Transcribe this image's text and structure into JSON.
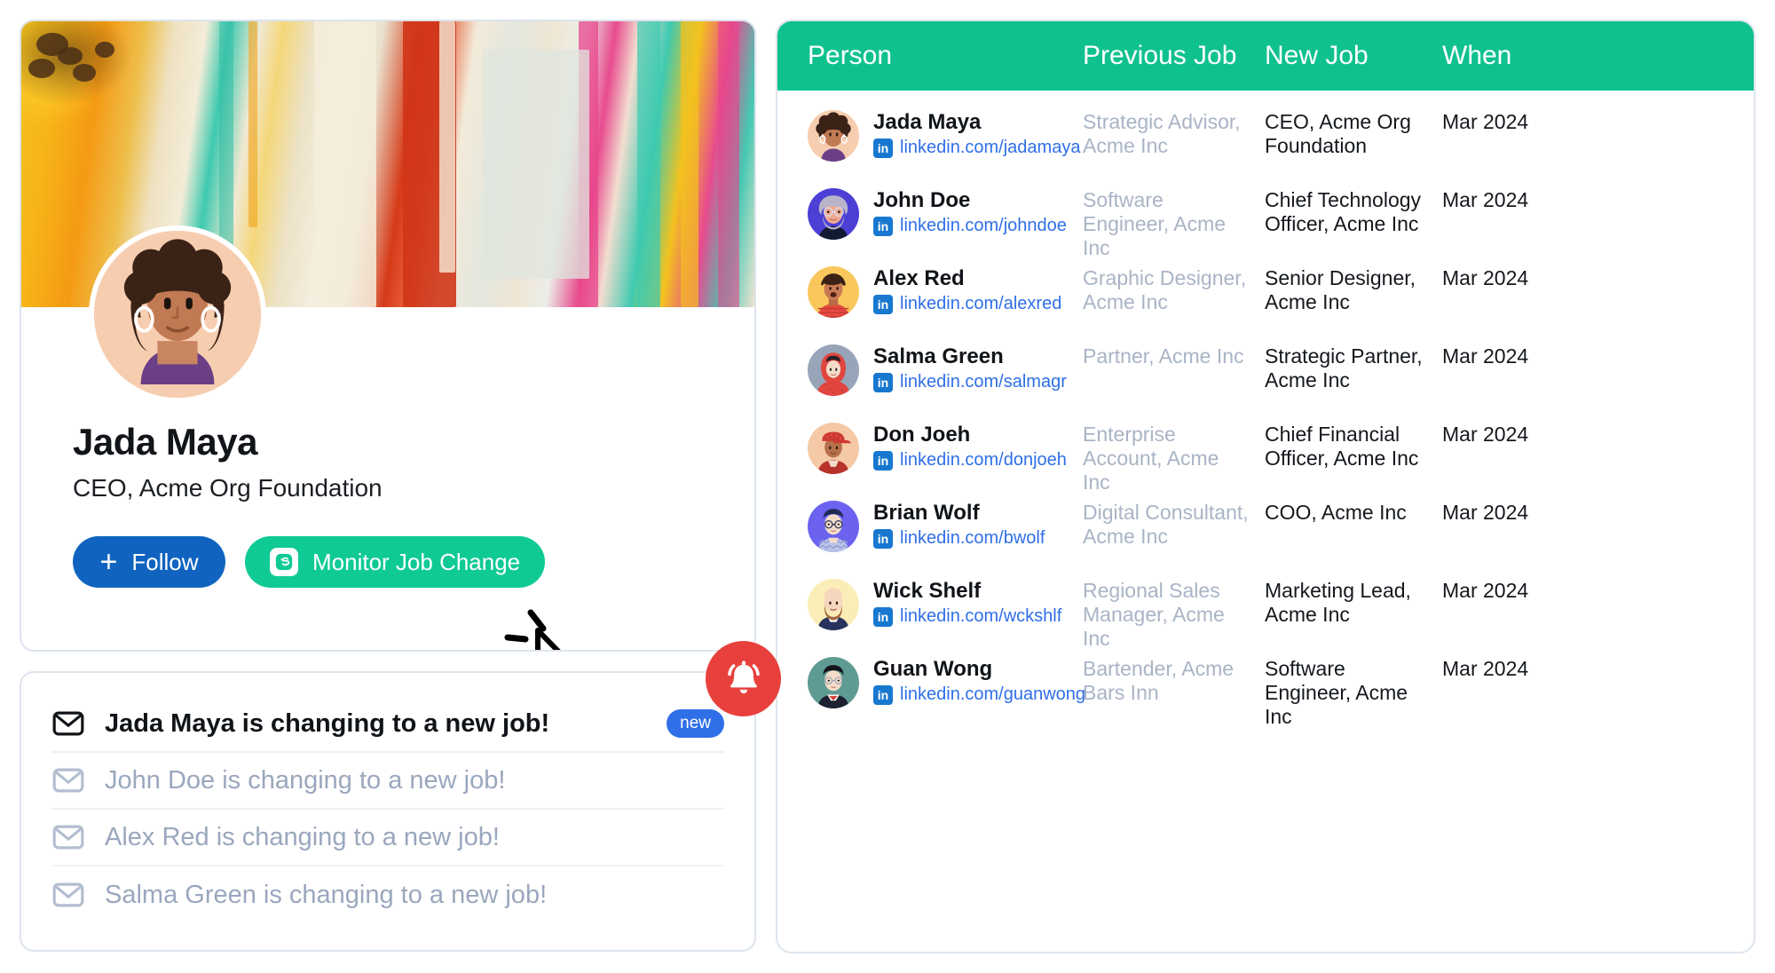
{
  "theme": {
    "accent_green": "#0fc18f",
    "accent_blue": "#1064c0",
    "badge_blue": "#2f6fe8",
    "linkedin_blue": "#1878cf",
    "bell_red": "#e8403c",
    "muted_text": "#a9b4c6",
    "card_border": "#dde4ed"
  },
  "profile": {
    "banner_icon": "abstract-paint-banner",
    "avatar_icon": "avatar-jada-maya",
    "name": "Jada Maya",
    "title": "CEO, Acme Org Foundation",
    "follow_label": "Follow",
    "follow_plus": "+",
    "monitor_label": "Monitor Job Change",
    "monitor_icon": "surfe-logo-icon"
  },
  "notifications": {
    "bell_icon": "bell-icon",
    "items": [
      {
        "icon": "envelope-icon",
        "text": "Jada Maya is changing to a new job!",
        "state": "unread",
        "badge": "new"
      },
      {
        "icon": "envelope-icon",
        "text": "John Doe is changing to a new job!",
        "state": "read",
        "badge": ""
      },
      {
        "icon": "envelope-icon",
        "text": "Alex Red is changing to a new job!",
        "state": "read",
        "badge": ""
      },
      {
        "icon": "envelope-icon",
        "text": "Salma Green is changing to a new job!",
        "state": "read",
        "badge": ""
      }
    ]
  },
  "table": {
    "columns": [
      "Person",
      "Previous Job",
      "New Job",
      "When"
    ],
    "rows": [
      {
        "avatar_icon": "avatar-jada-maya",
        "name": "Jada Maya",
        "link": "linkedin.com/jadamaya",
        "previous_job": "Strategic Advisor, Acme Inc",
        "new_job": "CEO, Acme Org Foundation",
        "when": "Mar 2024"
      },
      {
        "avatar_icon": "avatar-john-doe",
        "name": "John Doe",
        "link": "linkedin.com/johndoe",
        "previous_job": "Software Engineer, Acme Inc",
        "new_job": "Chief Technology Officer, Acme Inc",
        "when": "Mar 2024"
      },
      {
        "avatar_icon": "avatar-alex-red",
        "name": "Alex Red",
        "link": "linkedin.com/alexred",
        "previous_job": "Graphic Designer, Acme Inc",
        "new_job": "Senior Designer, Acme Inc",
        "when": "Mar 2024"
      },
      {
        "avatar_icon": "avatar-salma-green",
        "name": "Salma Green",
        "link": "linkedin.com/salmagr",
        "previous_job": "Partner, Acme Inc",
        "new_job": "Strategic Partner, Acme Inc",
        "when": "Mar 2024"
      },
      {
        "avatar_icon": "avatar-don-joeh",
        "name": "Don Joeh",
        "link": "linkedin.com/donjoeh",
        "previous_job": "Enterprise Account, Acme Inc",
        "new_job": "Chief Financial Officer, Acme Inc",
        "when": "Mar 2024"
      },
      {
        "avatar_icon": "avatar-brian-wolf",
        "name": "Brian Wolf",
        "link": "linkedin.com/bwolf",
        "previous_job": "Digital Consultant, Acme Inc",
        "new_job": "COO, Acme Inc",
        "when": "Mar 2024"
      },
      {
        "avatar_icon": "avatar-wick-shelf",
        "name": "Wick Shelf",
        "link": "linkedin.com/wckshlf",
        "previous_job": "Regional Sales Manager, Acme Inc",
        "new_job": "Marketing Lead, Acme Inc",
        "when": "Mar 2024"
      },
      {
        "avatar_icon": "avatar-guan-wong",
        "name": "Guan Wong",
        "link": "linkedin.com/guanwong",
        "previous_job": "Bartender, Acme Bars Inn",
        "new_job": "Software Engineer, Acme Inc",
        "when": "Mar 2024"
      }
    ]
  }
}
